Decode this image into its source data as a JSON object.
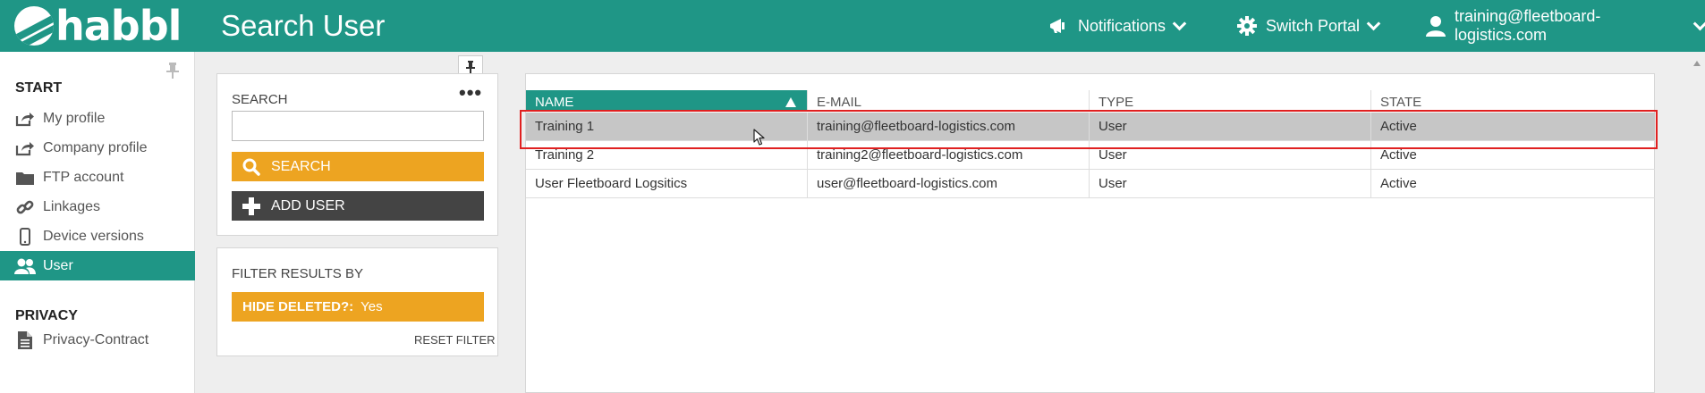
{
  "header": {
    "logo_text": "habbl",
    "title": "Search User",
    "notifications_label": "Notifications",
    "switch_portal_label": "Switch Portal",
    "user_email": "training@fleetboard-logistics.com",
    "brand_color": "#1f9686"
  },
  "sidebar": {
    "section_start": "START",
    "section_privacy": "PRIVACY",
    "items": [
      {
        "label": "My profile",
        "icon": "external-link-icon"
      },
      {
        "label": "Company profile",
        "icon": "external-link-icon"
      },
      {
        "label": "FTP account",
        "icon": "folder-icon"
      },
      {
        "label": "Linkages",
        "icon": "link-icon"
      },
      {
        "label": "Device versions",
        "icon": "phone-icon"
      },
      {
        "label": "User",
        "icon": "users-icon",
        "active": true
      }
    ],
    "privacy_items": [
      {
        "label": "Privacy-Contract",
        "icon": "document-icon"
      }
    ]
  },
  "search_panel": {
    "label": "SEARCH",
    "input_value": "",
    "search_button": "SEARCH",
    "add_user_button": "ADD USER",
    "accent_color": "#eda421"
  },
  "filter_panel": {
    "label": "FILTER RESULTS BY",
    "filter_name": "HIDE DELETED?:",
    "filter_value": "Yes",
    "reset_label": "RESET FILTER"
  },
  "table": {
    "columns": [
      "NAME",
      "E-MAIL",
      "TYPE",
      "STATE"
    ],
    "sorted_column": "NAME",
    "sort_direction": "ascending",
    "rows": [
      {
        "name": "Training 1",
        "email": "training@fleetboard-logistics.com",
        "type": "User",
        "state": "Active",
        "selected": true
      },
      {
        "name": "Training 2",
        "email": "training2@fleetboard-logistics.com",
        "type": "User",
        "state": "Active"
      },
      {
        "name": "User Fleetboard Logsitics",
        "email": "user@fleetboard-logistics.com",
        "type": "User",
        "state": "Active"
      }
    ]
  }
}
